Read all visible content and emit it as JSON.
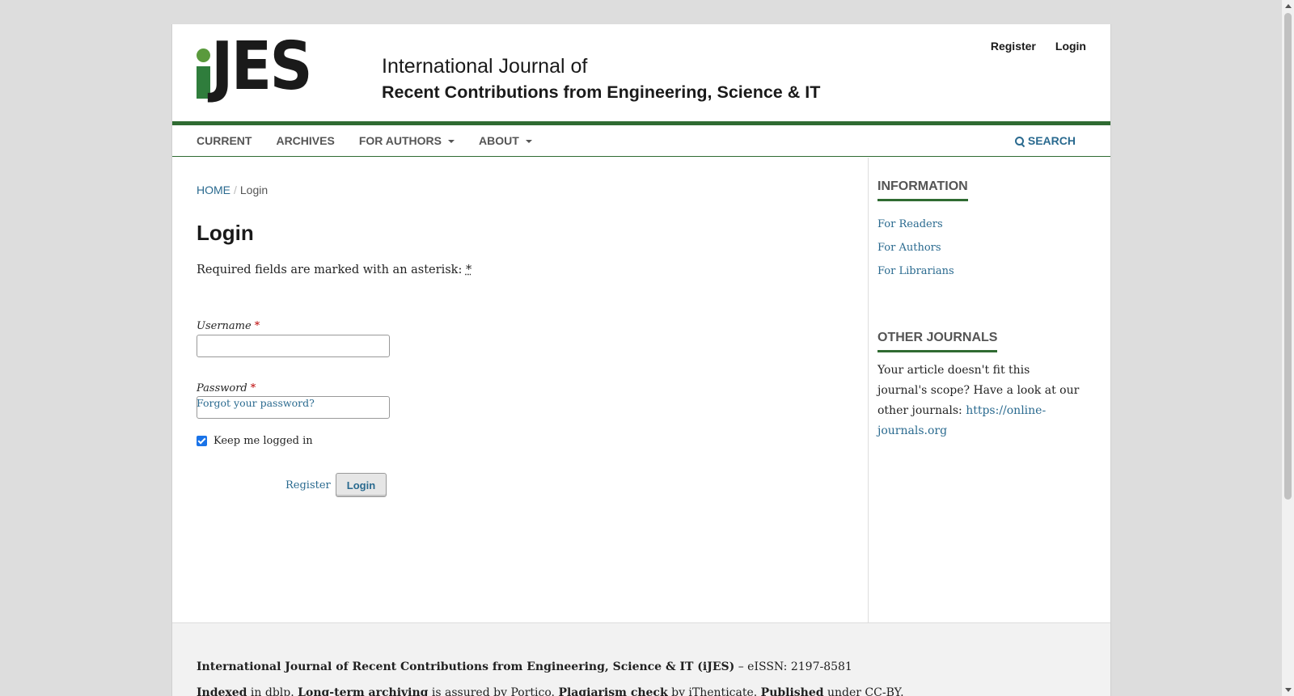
{
  "header": {
    "logo_text": "JES",
    "journal_line1": "International Journal of",
    "journal_line2": "Recent Contributions from Engineering, Science & IT",
    "user_nav": {
      "register": "Register",
      "login": "Login"
    }
  },
  "nav": {
    "items": [
      {
        "label": "Current",
        "has_menu": false
      },
      {
        "label": "Archives",
        "has_menu": false
      },
      {
        "label": "For Authors",
        "has_menu": true
      },
      {
        "label": "About",
        "has_menu": true
      }
    ],
    "search_label": "Search"
  },
  "breadcrumb": {
    "home": "Home",
    "separator": "/",
    "current": "Login"
  },
  "form": {
    "title": "Login",
    "required_note": "Required fields are marked with an asterisk:",
    "asterisk": "*",
    "username_label": "Username",
    "username_value": "",
    "password_label": "Password",
    "password_value": "",
    "forgot_link": "Forgot your password?",
    "keep_logged_in": "Keep me logged in",
    "keep_logged_in_checked": true,
    "register_link": "Register",
    "login_button": "Login"
  },
  "sidebar": {
    "information_title": "Information",
    "information_links": [
      "For Readers",
      "For Authors",
      "For Librarians"
    ],
    "other_title": "Other Journals",
    "other_text": "Your article doesn't fit this journal's scope? Have a look at our other journals:",
    "other_link": "https://online-journals.org"
  },
  "footer": {
    "journal_name": "International Journal of Recent Contributions from Engineering, Science & IT (iJES)",
    "issn": " – eISSN: 2197-8581",
    "indexed_b": "Indexed",
    "indexed_t": " in dblp. ",
    "archiving_b": "Long-term archiving",
    "archiving_t": " is assured by Portico. ",
    "plagiarism_b": "Plagiarism check",
    "plagiarism_t": " by iThenticate. ",
    "published_b": "Published",
    "published_t": " under CC-BY."
  },
  "colors": {
    "accent_green": "#2f6b32",
    "link_blue": "#2a6a8f",
    "page_bg": "#dddddd"
  }
}
